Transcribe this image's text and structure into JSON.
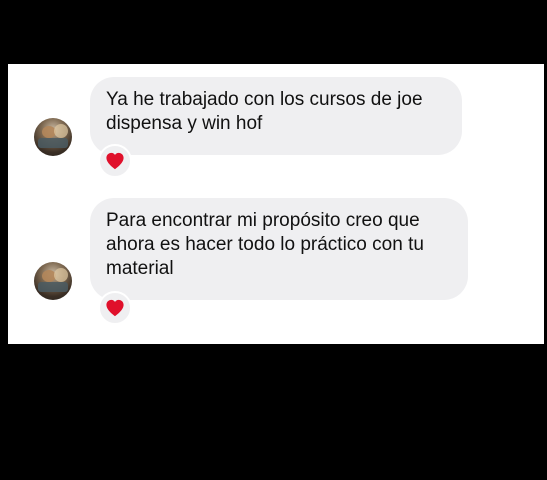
{
  "messages": [
    {
      "lines": [
        "Ya he trabajado con los cursos de joe",
        "dispensa y win hof"
      ],
      "reaction": "heart-icon"
    },
    {
      "lines": [
        "Para encontrar mi propósito creo que",
        "ahora es hacer todo lo práctico con tu",
        "material"
      ],
      "reaction": "heart-icon"
    }
  ],
  "colors": {
    "background": "#000000",
    "panel": "#ffffff",
    "bubble": "#efeff1",
    "text": "#111111",
    "heart": "#e0102b"
  }
}
